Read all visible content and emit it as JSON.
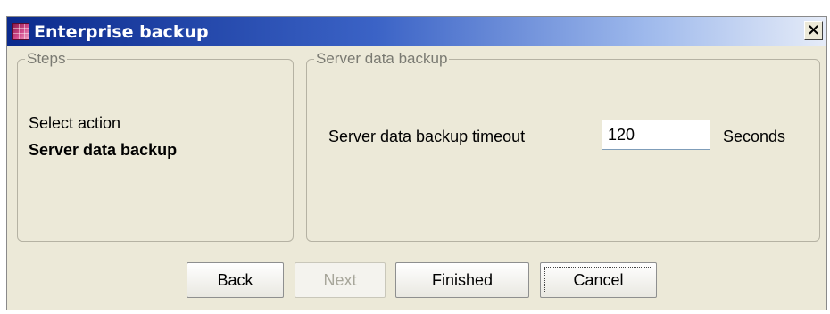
{
  "window": {
    "title": "Enterprise backup",
    "close_symbol": "×"
  },
  "steps": {
    "legend": "Steps",
    "items": [
      {
        "label": "Select action",
        "current": false
      },
      {
        "label": "Server data backup",
        "current": true
      }
    ]
  },
  "server_backup": {
    "legend": "Server data backup",
    "timeout_label": "Server data backup timeout",
    "timeout_value": "120",
    "unit_label": "Seconds"
  },
  "buttons": {
    "back": "Back",
    "next": "Next",
    "finished": "Finished",
    "cancel": "Cancel"
  },
  "icons": {
    "app": "enterprise-app-icon",
    "close": "close-icon"
  },
  "colors": {
    "titlebar_start": "#0b2a8c",
    "titlebar_end": "#e6ecf8",
    "dialog_background": "#ece9d8"
  }
}
